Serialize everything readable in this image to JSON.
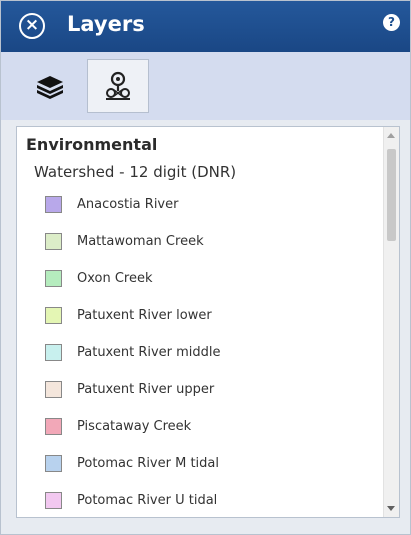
{
  "header": {
    "title": "Layers",
    "close_icon": "close-circle-icon",
    "help_icon": "help-icon",
    "background_color": "#1d4f8f"
  },
  "toolbar": {
    "buttons": [
      {
        "icon": "layers-stack-icon",
        "selected": false
      },
      {
        "icon": "legend-map-icon",
        "selected": true
      }
    ]
  },
  "legend": {
    "section_title": "Environmental",
    "group_title": "Watershed - 12 digit (DNR)",
    "items": [
      {
        "label": "Anacostia River",
        "color": "#b8a8ea"
      },
      {
        "label": "Mattawoman Creek",
        "color": "#dcedc8"
      },
      {
        "label": "Oxon Creek",
        "color": "#b5ecbe"
      },
      {
        "label": "Patuxent River lower",
        "color": "#e4f6b4"
      },
      {
        "label": "Patuxent River middle",
        "color": "#c8f0ee"
      },
      {
        "label": "Patuxent River upper",
        "color": "#f4e6dc"
      },
      {
        "label": "Piscataway Creek",
        "color": "#f2a8b8"
      },
      {
        "label": "Potomac River M tidal",
        "color": "#b8d2ee"
      },
      {
        "label": "Potomac River U tidal",
        "color": "#f2c8f0"
      }
    ]
  }
}
